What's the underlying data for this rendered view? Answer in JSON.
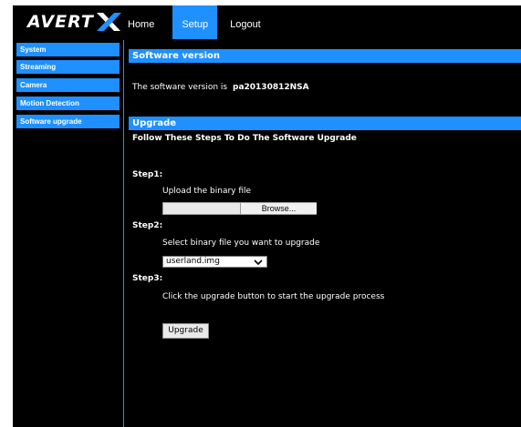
{
  "header": {
    "logo_text": "AVERT",
    "nav": [
      "Home",
      "Setup",
      "Logout"
    ],
    "active_nav": "Setup"
  },
  "sidebar": {
    "items": [
      "System",
      "Streaming",
      "Camera",
      "Motion Detection",
      "Software upgrade"
    ]
  },
  "software_version": {
    "header": "Software version",
    "label": "The software version is",
    "value": "pa20130812NSA"
  },
  "upgrade": {
    "header": "Upgrade",
    "intro": "Follow These Steps To Do The Software Upgrade",
    "step1_label": "Step1:",
    "step1_text": "Upload the binary file",
    "browse_label": "Browse...",
    "step2_label": "Step2:",
    "step2_text": "Select binary file you want to upgrade",
    "select_value": "userland.img",
    "step3_label": "Step3:",
    "step3_text": "Click the upgrade button to start the upgrade process",
    "button_label": "Upgrade"
  },
  "colors": {
    "accent": "#1e90ff",
    "background": "#000000"
  }
}
